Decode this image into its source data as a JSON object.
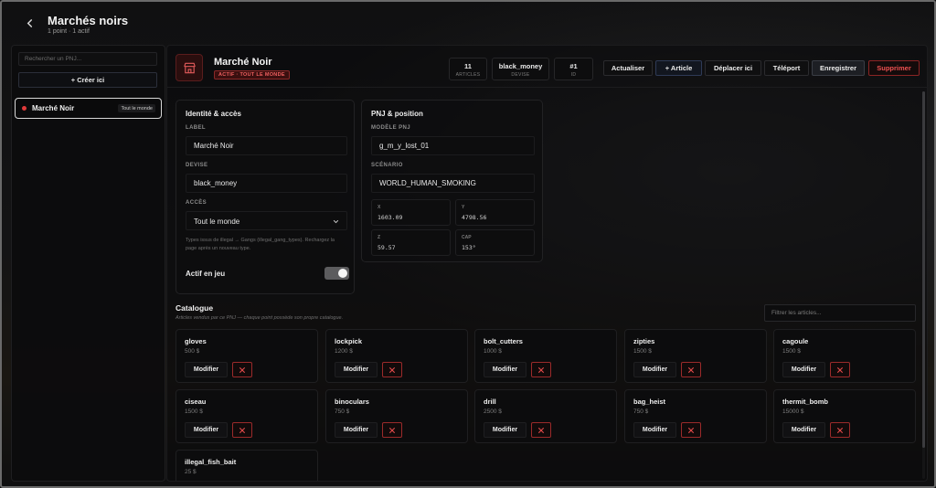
{
  "header": {
    "title": "Marchés noirs",
    "subtitle": "1 point · 1 actif"
  },
  "sidebar": {
    "search_placeholder": "Rechercher un PNJ...",
    "create_label": "+ Créer ici",
    "items": [
      {
        "label": "Marché Noir",
        "badge": "Tout le monde",
        "status_color": "#e03a3a"
      }
    ]
  },
  "shop": {
    "title": "Marché Noir",
    "tag": "ACTIF · TOUT LE MONDE",
    "icon": "storefront-icon",
    "stats": [
      {
        "value": "11",
        "label": "ARTICLES"
      },
      {
        "value": "black_money",
        "label": "DEVISE"
      },
      {
        "value": "#1",
        "label": "ID"
      }
    ],
    "actions": {
      "refresh": "Actualiser",
      "add_item": "+ Article",
      "move_here": "Déplacer ici",
      "teleport": "Téléport",
      "save": "Enregistrer",
      "delete": "Supprimer"
    }
  },
  "identity": {
    "title": "Identité & accès",
    "label_label": "LABEL",
    "label_value": "Marché Noir",
    "currency_label": "DEVISE",
    "currency_value": "black_money",
    "access_label": "ACCÈS",
    "access_value": "Tout le monde",
    "help": "Types issus de illegal → Gangs (illegal_gang_types). Rechargez la page après un nouveau type.",
    "active_label": "Actif en jeu",
    "active": true
  },
  "npc": {
    "title": "PNJ & position",
    "model_label": "MODÈLE PNJ",
    "model_value": "g_m_y_lost_01",
    "scenario_label": "SCÉNARIO",
    "scenario_value": "WORLD_HUMAN_SMOKING",
    "coords": [
      {
        "label": "X",
        "value": "1603.09"
      },
      {
        "label": "Y",
        "value": "4798.56"
      },
      {
        "label": "Z",
        "value": "59.57"
      },
      {
        "label": "CAP",
        "value": "153°"
      }
    ]
  },
  "catalog": {
    "title": "Catalogue",
    "subtitle": "Articles vendus par ce PNJ — chaque point possède son propre catalogue.",
    "filter_placeholder": "Filtrer les articles...",
    "edit_label": "Modifier",
    "items": [
      {
        "name": "gloves",
        "price": "500 $"
      },
      {
        "name": "lockpick",
        "price": "1200 $"
      },
      {
        "name": "bolt_cutters",
        "price": "1000 $"
      },
      {
        "name": "zipties",
        "price": "1500 $"
      },
      {
        "name": "cagoule",
        "price": "1500 $"
      },
      {
        "name": "ciseau",
        "price": "1500 $"
      },
      {
        "name": "binoculars",
        "price": "750 $"
      },
      {
        "name": "drill",
        "price": "2500 $"
      },
      {
        "name": "bag_heist",
        "price": "750 $"
      },
      {
        "name": "thermit_bomb",
        "price": "15000 $"
      },
      {
        "name": "illegal_fish_bait",
        "price": "25 $"
      }
    ]
  }
}
